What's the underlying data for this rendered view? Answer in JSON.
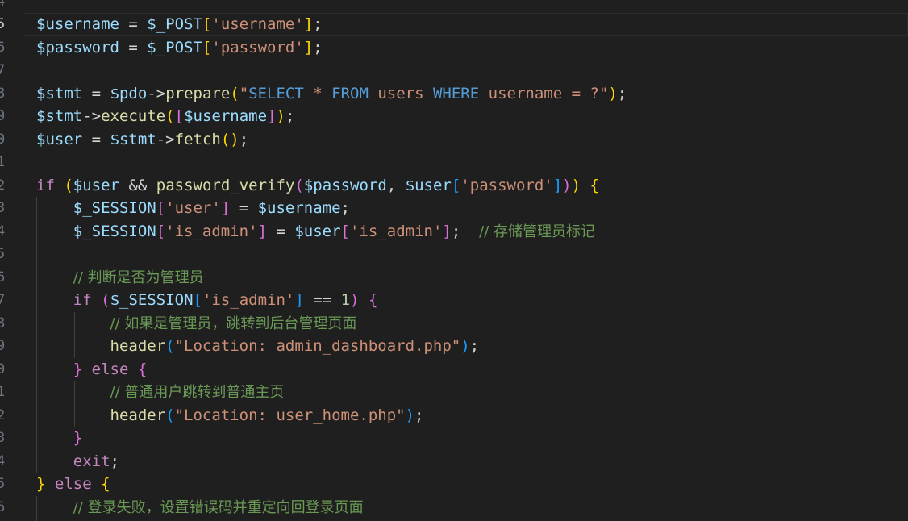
{
  "editor": {
    "language": "php",
    "theme": "dark",
    "line_numbers": [
      "4",
      "5",
      "6",
      "7",
      "8",
      "9",
      "0",
      "1",
      "2",
      "3",
      "4",
      "5",
      "6",
      "7",
      "8",
      "9",
      "0",
      "1",
      "2",
      "3",
      "4",
      "5",
      "6"
    ],
    "lines": {
      "l1": [
        {
          "t": "$username",
          "c": "t-var"
        },
        {
          "t": " = ",
          "c": "t-op"
        },
        {
          "t": "$_POST",
          "c": "t-var"
        },
        {
          "t": "[",
          "c": "b1"
        },
        {
          "t": "'username'",
          "c": "t-str"
        },
        {
          "t": "]",
          "c": "b1"
        },
        {
          "t": ";",
          "c": "t-op"
        }
      ],
      "l2": [
        {
          "t": "$password",
          "c": "t-var"
        },
        {
          "t": " = ",
          "c": "t-op"
        },
        {
          "t": "$_POST",
          "c": "t-var"
        },
        {
          "t": "[",
          "c": "b1"
        },
        {
          "t": "'password'",
          "c": "t-str"
        },
        {
          "t": "]",
          "c": "b1"
        },
        {
          "t": ";",
          "c": "t-op"
        }
      ],
      "l4": [
        {
          "t": "$stmt",
          "c": "t-var"
        },
        {
          "t": " = ",
          "c": "t-op"
        },
        {
          "t": "$pdo",
          "c": "t-var"
        },
        {
          "t": "->",
          "c": "t-op"
        },
        {
          "t": "prepare",
          "c": "t-fn"
        },
        {
          "t": "(",
          "c": "b1"
        },
        {
          "t": "\"",
          "c": "t-str"
        },
        {
          "t": "SELECT",
          "c": "t-kw"
        },
        {
          "t": " * ",
          "c": "t-str"
        },
        {
          "t": "FROM",
          "c": "t-kw"
        },
        {
          "t": " users ",
          "c": "t-str"
        },
        {
          "t": "WHERE",
          "c": "t-kw"
        },
        {
          "t": " username = ?\"",
          "c": "t-str"
        },
        {
          "t": ")",
          "c": "b1"
        },
        {
          "t": ";",
          "c": "t-op"
        }
      ],
      "l5": [
        {
          "t": "$stmt",
          "c": "t-var"
        },
        {
          "t": "->",
          "c": "t-op"
        },
        {
          "t": "execute",
          "c": "t-fn"
        },
        {
          "t": "(",
          "c": "b1"
        },
        {
          "t": "[",
          "c": "b2"
        },
        {
          "t": "$username",
          "c": "t-var"
        },
        {
          "t": "]",
          "c": "b2"
        },
        {
          "t": ")",
          "c": "b1"
        },
        {
          "t": ";",
          "c": "t-op"
        }
      ],
      "l6": [
        {
          "t": "$user",
          "c": "t-var"
        },
        {
          "t": " = ",
          "c": "t-op"
        },
        {
          "t": "$stmt",
          "c": "t-var"
        },
        {
          "t": "->",
          "c": "t-op"
        },
        {
          "t": "fetch",
          "c": "t-fn"
        },
        {
          "t": "()",
          "c": "b1"
        },
        {
          "t": ";",
          "c": "t-op"
        }
      ],
      "l8": [
        {
          "t": "if",
          "c": "t-ctl"
        },
        {
          "t": " ",
          "c": "t-op"
        },
        {
          "t": "(",
          "c": "b1"
        },
        {
          "t": "$user",
          "c": "t-var"
        },
        {
          "t": " && ",
          "c": "t-op"
        },
        {
          "t": "password_verify",
          "c": "t-fn"
        },
        {
          "t": "(",
          "c": "b2"
        },
        {
          "t": "$password",
          "c": "t-var"
        },
        {
          "t": ", ",
          "c": "t-op"
        },
        {
          "t": "$user",
          "c": "t-var"
        },
        {
          "t": "[",
          "c": "b3"
        },
        {
          "t": "'password'",
          "c": "t-str"
        },
        {
          "t": "]",
          "c": "b3"
        },
        {
          "t": ")",
          "c": "b2"
        },
        {
          "t": ")",
          "c": "b1"
        },
        {
          "t": " ",
          "c": "t-op"
        },
        {
          "t": "{",
          "c": "b1"
        }
      ],
      "l9": [
        {
          "t": "    ",
          "c": "t-op"
        },
        {
          "t": "$_SESSION",
          "c": "t-var"
        },
        {
          "t": "[",
          "c": "b2"
        },
        {
          "t": "'user'",
          "c": "t-str"
        },
        {
          "t": "]",
          "c": "b2"
        },
        {
          "t": " = ",
          "c": "t-op"
        },
        {
          "t": "$username",
          "c": "t-var"
        },
        {
          "t": ";",
          "c": "t-op"
        }
      ],
      "l10": [
        {
          "t": "    ",
          "c": "t-op"
        },
        {
          "t": "$_SESSION",
          "c": "t-var"
        },
        {
          "t": "[",
          "c": "b2"
        },
        {
          "t": "'is_admin'",
          "c": "t-str"
        },
        {
          "t": "]",
          "c": "b2"
        },
        {
          "t": " = ",
          "c": "t-op"
        },
        {
          "t": "$user",
          "c": "t-var"
        },
        {
          "t": "[",
          "c": "b2"
        },
        {
          "t": "'is_admin'",
          "c": "t-str"
        },
        {
          "t": "]",
          "c": "b2"
        },
        {
          "t": ";  ",
          "c": "t-op"
        },
        {
          "t": "// 存储管理员标记",
          "c": "t-cmt"
        }
      ],
      "l12": [
        {
          "t": "    ",
          "c": "t-op"
        },
        {
          "t": "// 判断是否为管理员",
          "c": "t-cmt"
        }
      ],
      "l13": [
        {
          "t": "    ",
          "c": "t-op"
        },
        {
          "t": "if",
          "c": "t-ctl"
        },
        {
          "t": " ",
          "c": "t-op"
        },
        {
          "t": "(",
          "c": "b2"
        },
        {
          "t": "$_SESSION",
          "c": "t-var"
        },
        {
          "t": "[",
          "c": "b3"
        },
        {
          "t": "'is_admin'",
          "c": "t-str"
        },
        {
          "t": "]",
          "c": "b3"
        },
        {
          "t": " == ",
          "c": "t-op"
        },
        {
          "t": "1",
          "c": "t-num"
        },
        {
          "t": ")",
          "c": "b2"
        },
        {
          "t": " ",
          "c": "t-op"
        },
        {
          "t": "{",
          "c": "b2"
        }
      ],
      "l14": [
        {
          "t": "        ",
          "c": "t-op"
        },
        {
          "t": "// 如果是管理员，跳转到后台管理页面",
          "c": "t-cmt"
        }
      ],
      "l15": [
        {
          "t": "        ",
          "c": "t-op"
        },
        {
          "t": "header",
          "c": "t-fn"
        },
        {
          "t": "(",
          "c": "b3"
        },
        {
          "t": "\"Location: admin_dashboard.php\"",
          "c": "t-str"
        },
        {
          "t": ")",
          "c": "b3"
        },
        {
          "t": ";",
          "c": "t-op"
        }
      ],
      "l16": [
        {
          "t": "    ",
          "c": "t-op"
        },
        {
          "t": "}",
          "c": "b2"
        },
        {
          "t": " ",
          "c": "t-op"
        },
        {
          "t": "else",
          "c": "t-ctl"
        },
        {
          "t": " ",
          "c": "t-op"
        },
        {
          "t": "{",
          "c": "b2"
        }
      ],
      "l17": [
        {
          "t": "        ",
          "c": "t-op"
        },
        {
          "t": "// 普通用户跳转到普通主页",
          "c": "t-cmt"
        }
      ],
      "l18": [
        {
          "t": "        ",
          "c": "t-op"
        },
        {
          "t": "header",
          "c": "t-fn"
        },
        {
          "t": "(",
          "c": "b3"
        },
        {
          "t": "\"Location: user_home.php\"",
          "c": "t-str"
        },
        {
          "t": ")",
          "c": "b3"
        },
        {
          "t": ";",
          "c": "t-op"
        }
      ],
      "l19": [
        {
          "t": "    ",
          "c": "t-op"
        },
        {
          "t": "}",
          "c": "b2"
        }
      ],
      "l20": [
        {
          "t": "    ",
          "c": "t-op"
        },
        {
          "t": "exit",
          "c": "t-ctl"
        },
        {
          "t": ";",
          "c": "t-op"
        }
      ],
      "l21": [
        {
          "t": "}",
          "c": "b1"
        },
        {
          "t": " ",
          "c": "t-op"
        },
        {
          "t": "else",
          "c": "t-ctl"
        },
        {
          "t": " ",
          "c": "t-op"
        },
        {
          "t": "{",
          "c": "b1"
        }
      ],
      "l22": [
        {
          "t": "    ",
          "c": "t-op"
        },
        {
          "t": "// 登录失败，设置错误码并重定向回登录页面",
          "c": "t-cmt"
        }
      ]
    }
  }
}
